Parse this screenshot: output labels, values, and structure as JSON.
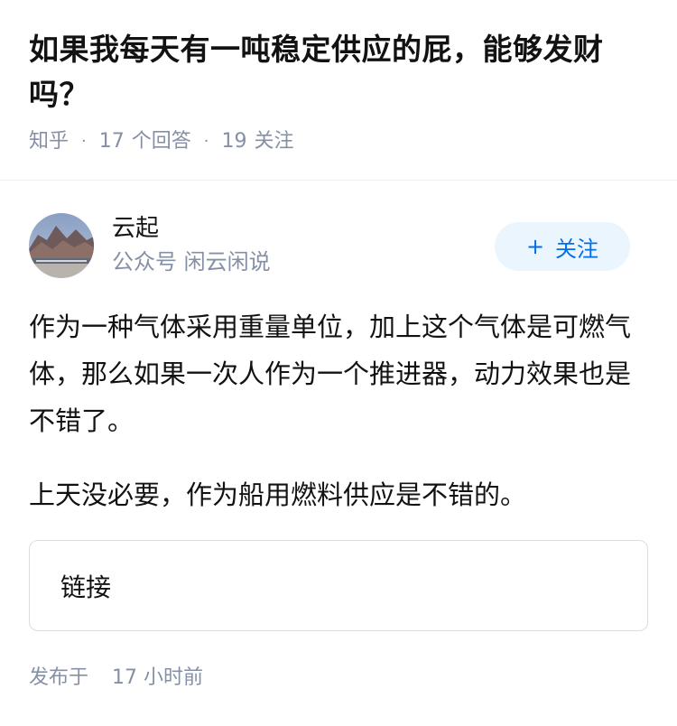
{
  "question": {
    "title": "如果我每天有一吨稳定供应的屁，能够发财吗？",
    "source": "知乎",
    "answer_count": "17",
    "answer_label": "个回答",
    "follower_count": "19",
    "follower_label": "关注"
  },
  "author": {
    "name": "云起",
    "description": "公众号 闲云闲说",
    "avatar_icon": "mountain-landscape-avatar",
    "follow_plus": "+",
    "follow_label": "关注"
  },
  "answer": {
    "paragraphs": [
      "作为一种气体采用重量单位，加上这个气体是可燃气体，那么如果一次人作为一个推进器，动力效果也是不错了。",
      "上天没必要，作为船用燃料供应是不错的。"
    ],
    "link_label": "链接",
    "publish_prefix": "发布于",
    "publish_time": "17 小时前"
  },
  "colors": {
    "text_primary": "#121212",
    "text_secondary": "#8590a6",
    "accent": "#056de8",
    "follow_bg": "#ebf5fd"
  }
}
